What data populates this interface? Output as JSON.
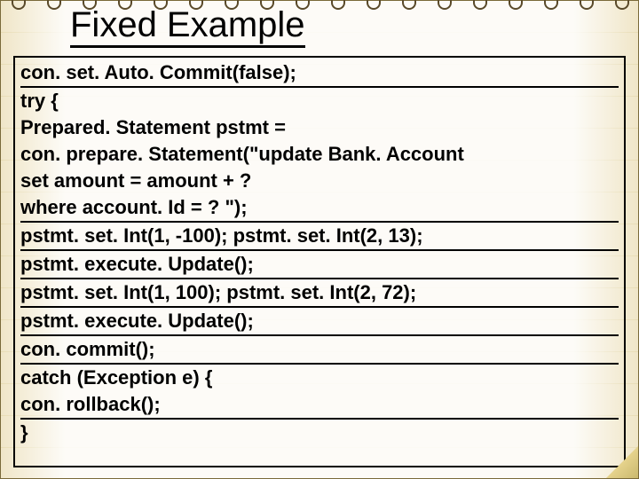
{
  "title": "Fixed Example",
  "code": {
    "l1": "con. set. Auto. Commit(false);",
    "l2": "try {",
    "l3": "Prepared. Statement pstmt =",
    "l4": "con. prepare. Statement(\"update Bank. Account",
    "l5": "set amount = amount + ?",
    "l6": "where account. Id = ? \");",
    "l7": "pstmt. set. Int(1, -100); pstmt. set. Int(2, 13);",
    "l8": "pstmt. execute. Update();",
    "l9": "pstmt. set. Int(1, 100); pstmt. set. Int(2, 72);",
    "l10": "pstmt. execute. Update();",
    "l11": "con. commit();",
    "l12": "catch (Exception e) {",
    "l13": "con. rollback();",
    "l14": "}"
  }
}
